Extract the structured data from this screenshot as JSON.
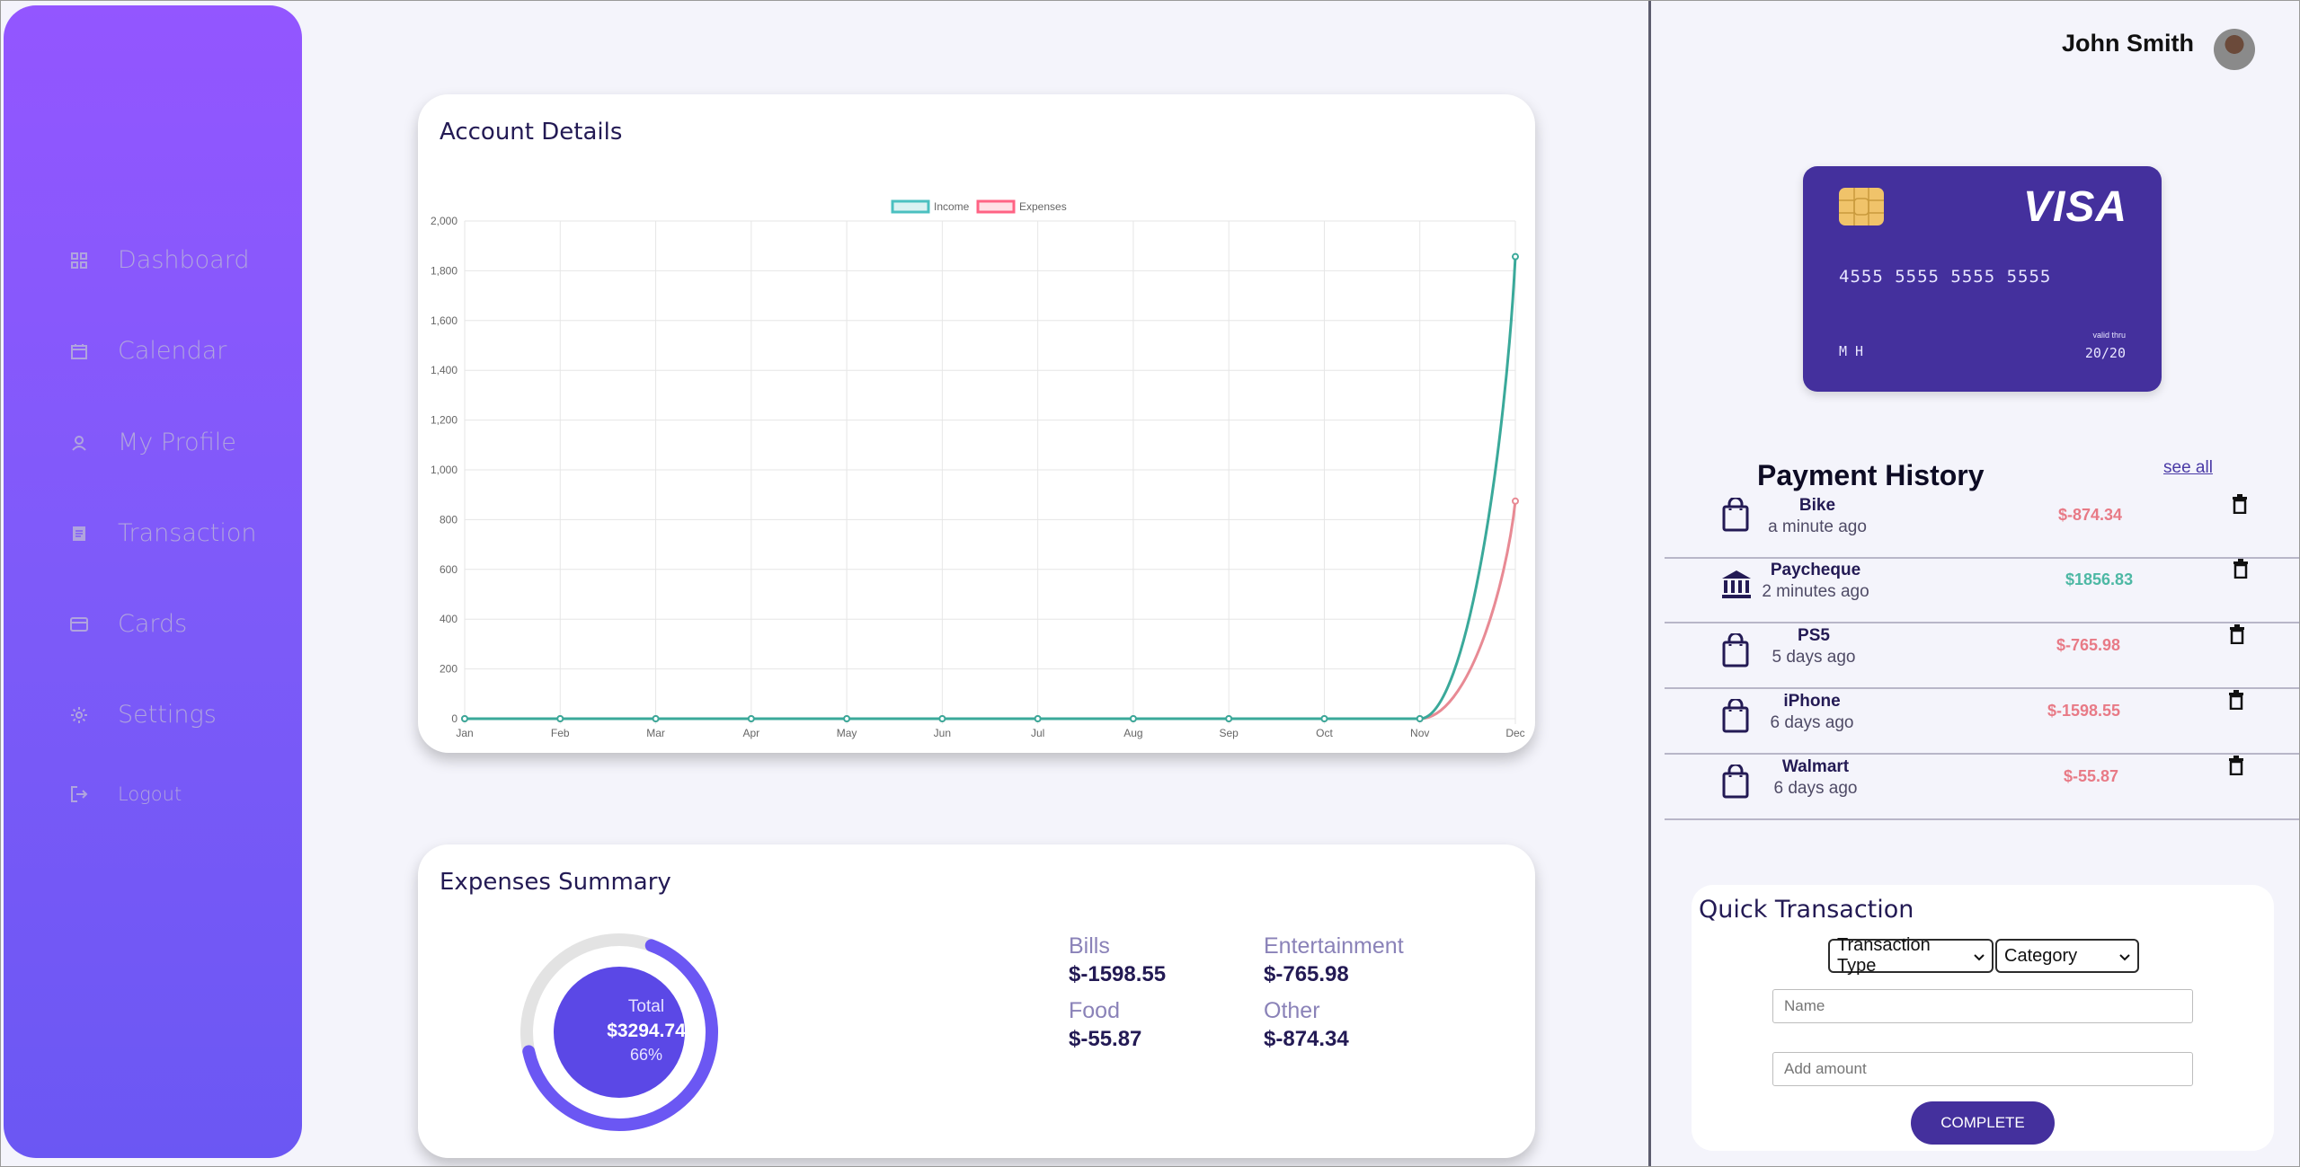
{
  "sidebar": {
    "items": [
      {
        "label": "Dashboard",
        "icon": "grid-icon"
      },
      {
        "label": "Calendar",
        "icon": "calendar-icon"
      },
      {
        "label": "My Profile",
        "icon": "user-icon"
      },
      {
        "label": "Transaction",
        "icon": "document-icon"
      },
      {
        "label": "Cards",
        "icon": "credit-card-icon"
      },
      {
        "label": "Settings",
        "icon": "gear-icon"
      },
      {
        "label": "Logout",
        "icon": "logout-icon"
      }
    ]
  },
  "account_details": {
    "title": "Account Details"
  },
  "chart_data": {
    "type": "line",
    "x": [
      "Jan",
      "Feb",
      "Mar",
      "Apr",
      "May",
      "Jun",
      "Jul",
      "Aug",
      "Sep",
      "Oct",
      "Nov",
      "Dec"
    ],
    "series": [
      {
        "name": "Income",
        "color": "#4bc0c0",
        "values": [
          0,
          0,
          0,
          0,
          0,
          0,
          0,
          0,
          0,
          0,
          0,
          1856.83
        ]
      },
      {
        "name": "Expenses",
        "color": "#ff6384",
        "values": [
          0,
          0,
          0,
          0,
          0,
          0,
          0,
          0,
          0,
          0,
          0,
          874.34
        ]
      }
    ],
    "ylim": [
      0,
      2000
    ],
    "yticks": [
      "0",
      "200",
      "400",
      "600",
      "800",
      "1,000",
      "1,200",
      "1,400",
      "1,600",
      "1,800",
      "2,000"
    ],
    "grid": true,
    "legend": "top-center"
  },
  "expenses_summary": {
    "title": "Expenses Summary",
    "total_label": "Total",
    "total_value": "$3294.74",
    "percent": "66%",
    "percent_value": 66,
    "items": [
      {
        "label": "Bills",
        "value": "$-1598.55"
      },
      {
        "label": "Entertainment",
        "value": "$-765.98"
      },
      {
        "label": "Food",
        "value": "$-55.87"
      },
      {
        "label": "Other",
        "value": "$-874.34"
      }
    ]
  },
  "user": {
    "name": "John Smith"
  },
  "card": {
    "brand": "VISA",
    "number": "4555 5555 5555 5555",
    "holder": "M H",
    "valid_label": "valid thru",
    "valid": "20/20"
  },
  "payment_history": {
    "title": "Payment History",
    "see_all": "see all",
    "rows": [
      {
        "name": "Bike",
        "time": "a minute ago",
        "amount": "$-874.34",
        "type": "expense",
        "icon": "shopping-bag-icon"
      },
      {
        "name": "Paycheque",
        "time": "2 minutes ago",
        "amount": "$1856.83",
        "type": "income",
        "icon": "bank-icon"
      },
      {
        "name": "PS5",
        "time": "5 days ago",
        "amount": "$-765.98",
        "type": "expense",
        "icon": "shopping-bag-icon"
      },
      {
        "name": "iPhone",
        "time": "6 days ago",
        "amount": "$-1598.55",
        "type": "expense",
        "icon": "shopping-bag-icon"
      },
      {
        "name": "Walmart",
        "time": "6 days ago",
        "amount": "$-55.87",
        "type": "expense",
        "icon": "shopping-bag-icon"
      }
    ]
  },
  "quick_transaction": {
    "title": "Quick Transaction",
    "type_select": "Transaction Type",
    "category_select": "Category",
    "name_placeholder": "Name",
    "amount_placeholder": "Add amount",
    "button": "COMPLETE"
  },
  "colors": {
    "accent": "#44309d",
    "expense": "#e87a86",
    "income": "#4db8a4",
    "sidebar_top": "#9356ff",
    "sidebar_bottom": "#6b57f3"
  }
}
